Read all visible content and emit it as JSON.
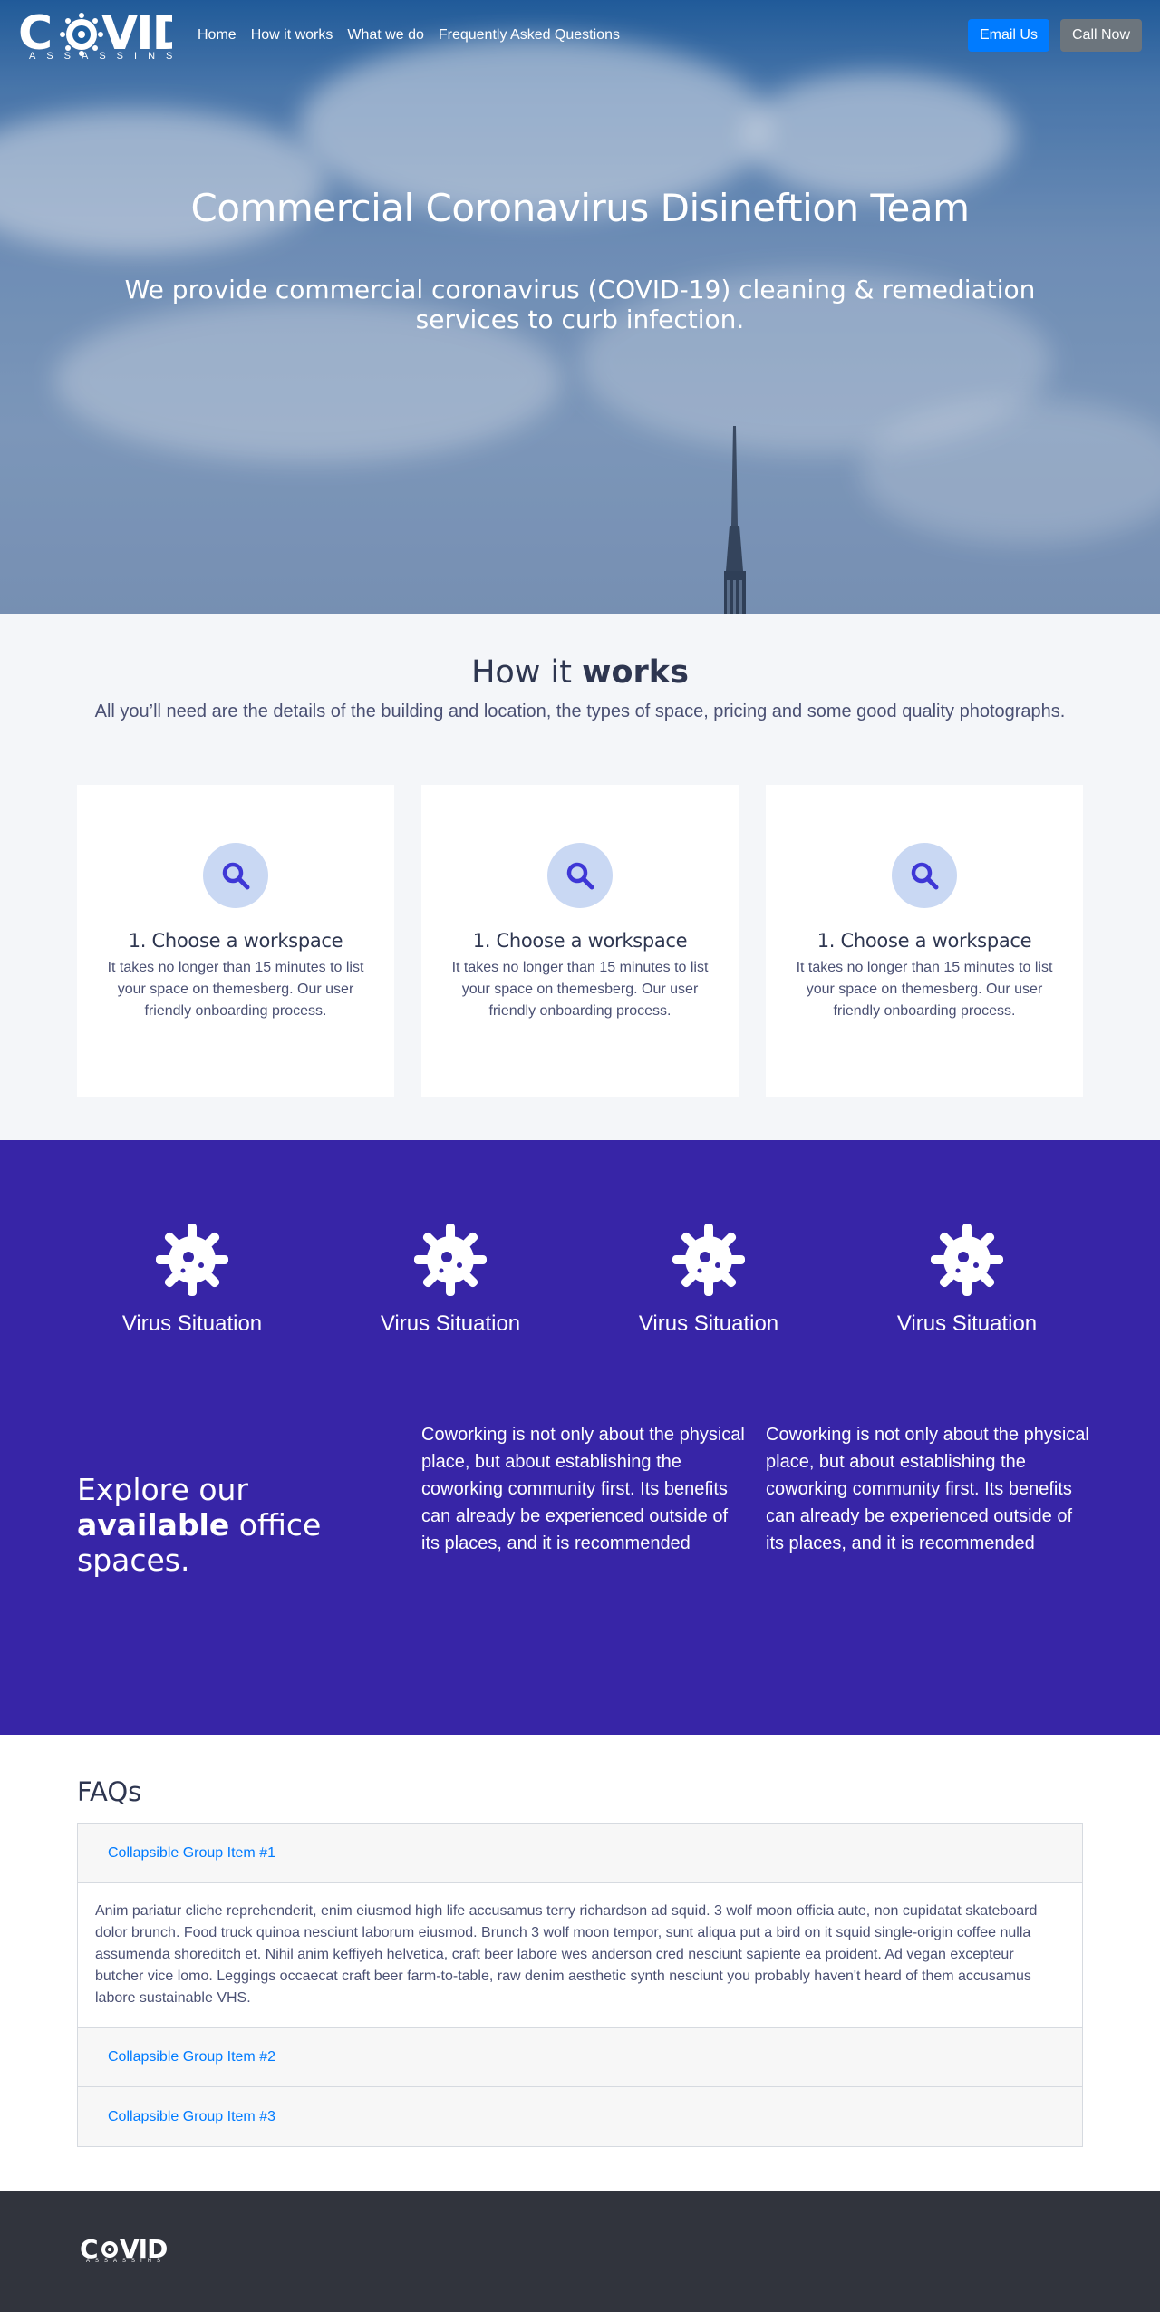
{
  "brand": {
    "name": "COVID",
    "tagline": "ASSASSINS"
  },
  "nav": {
    "links": [
      "Home",
      "How it works",
      "What we do",
      "Frequently Asked Questions"
    ],
    "email_label": "Email Us",
    "call_label": "Call Now"
  },
  "hero": {
    "title": "Commercial Coronavirus Disineftion Team",
    "lead": "We provide commercial coronavirus (COVID-19) cleaning & remediation services to curb infection."
  },
  "how": {
    "title_pre": "How it",
    "title_bold": "works",
    "subtitle": "All you’ll need are the details of the building and location, the types of space, pricing and some good quality photographs.",
    "cards": [
      {
        "icon": "search-icon",
        "title": "1. Choose a workspace",
        "text": "It takes no longer than 15 minutes to list your space on themesberg. Our user friendly onboarding process."
      },
      {
        "icon": "search-icon",
        "title": "1. Choose a workspace",
        "text": "It takes no longer than 15 minutes to list your space on themesberg. Our user friendly onboarding process."
      },
      {
        "icon": "search-icon",
        "title": "1. Choose a workspace",
        "text": "It takes no longer than 15 minutes to list your space on themesberg. Our user friendly onboarding process."
      }
    ]
  },
  "virus": {
    "items": [
      "Virus Situation",
      "Virus Situation",
      "Virus Situation",
      "Virus Situation"
    ],
    "icon": "virus-icon"
  },
  "explore": {
    "pre": "Explore our",
    "bold": "available",
    "post": "office spaces.",
    "col1": "Coworking is not only about the physical place, but about establishing the coworking community first. Its benefits can already be experienced outside of its places, and it is recommended",
    "col2": "Coworking is not only about the physical place, but about establishing the coworking community first. Its benefits can already be experienced outside of its places, and it is recommended"
  },
  "faq": {
    "title": "FAQs",
    "items": [
      {
        "label": "Collapsible Group Item #1",
        "body": "Anim pariatur cliche reprehenderit, enim eiusmod high life accusamus terry richardson ad squid. 3 wolf moon officia aute, non cupidatat skateboard dolor brunch. Food truck quinoa nesciunt laborum eiusmod. Brunch 3 wolf moon tempor, sunt aliqua put a bird on it squid single-origin coffee nulla assumenda shoreditch et. Nihil anim keffiyeh helvetica, craft beer labore wes anderson cred nesciunt sapiente ea proident. Ad vegan excepteur butcher vice lomo. Leggings occaecat craft beer farm-to-table, raw denim aesthetic synth nesciunt you probably haven't heard of them accusamus labore sustainable VHS."
      },
      {
        "label": "Collapsible Group Item #2"
      },
      {
        "label": "Collapsible Group Item #3"
      }
    ]
  },
  "colors": {
    "accent": "#007bff",
    "purple": "#3725a7",
    "footer": "#31343d",
    "icon_bg": "#c9d8f3",
    "icon": "#3e37d6"
  }
}
